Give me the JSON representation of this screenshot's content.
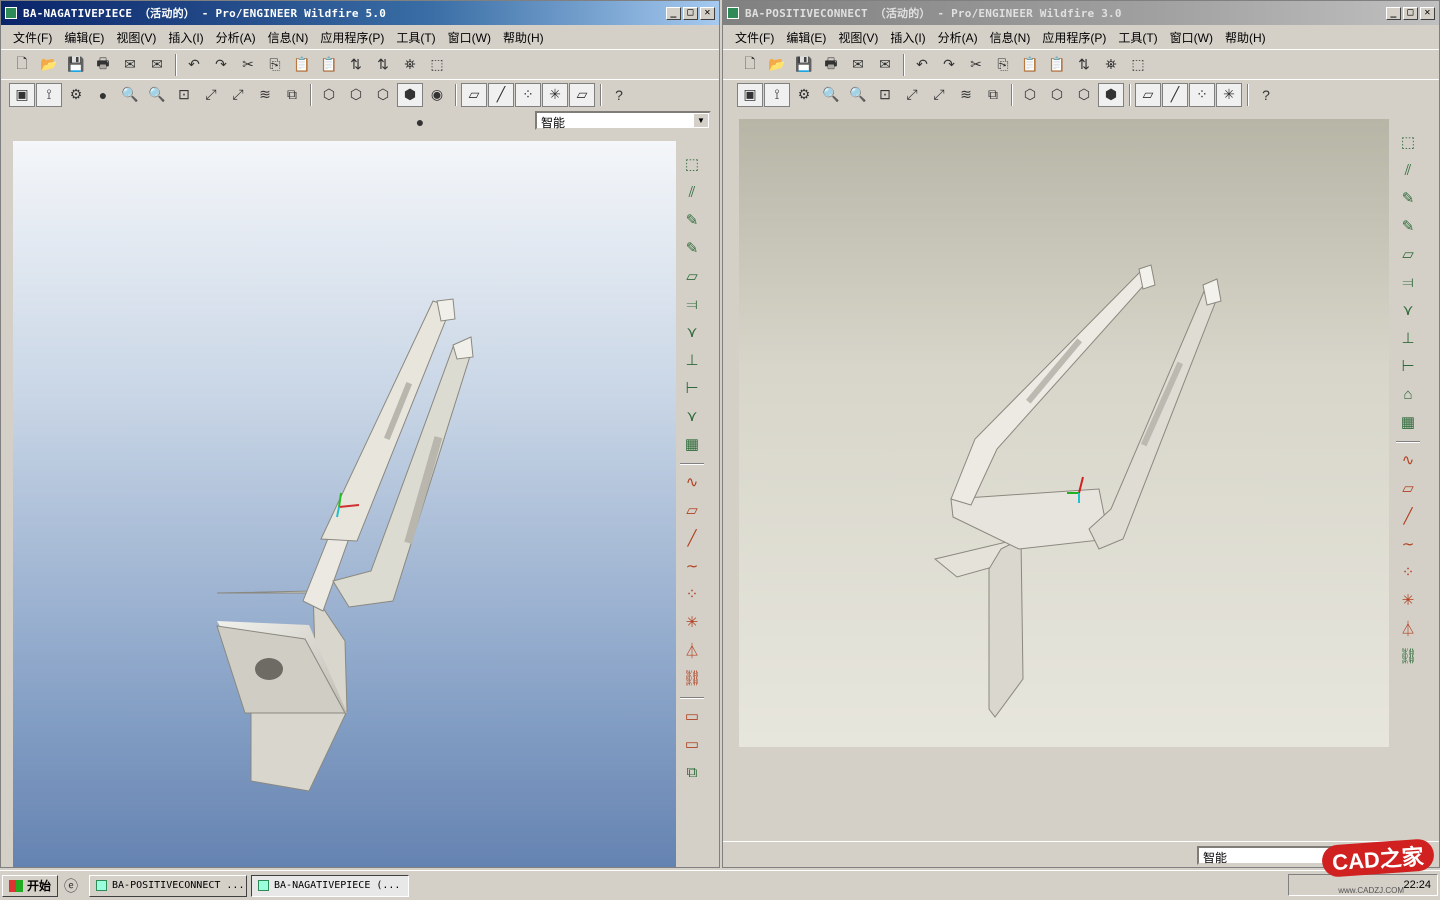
{
  "left_window": {
    "title": "BA-NAGATIVEPIECE （活动的） - Pro/ENGINEER Wildfire 5.0",
    "filter_value": "智能"
  },
  "right_window": {
    "title": "BA-POSITIVECONNECT （活动的） - Pro/ENGINEER Wildfire 3.0",
    "filter_value": "智能"
  },
  "menu": [
    "文件(F)",
    "编辑(E)",
    "视图(V)",
    "插入(I)",
    "分析(A)",
    "信息(N)",
    "应用程序(P)",
    "工具(T)",
    "窗口(W)",
    "帮助(H)"
  ],
  "taskbar": {
    "start_label": "开始",
    "tasks": [
      "BA-POSITIVECONNECT ...",
      "BA-NAGATIVEPIECE (..."
    ],
    "clock": "22:24"
  },
  "watermark": {
    "logo": "CAD之家",
    "url": "www.CADZJ.COM"
  }
}
